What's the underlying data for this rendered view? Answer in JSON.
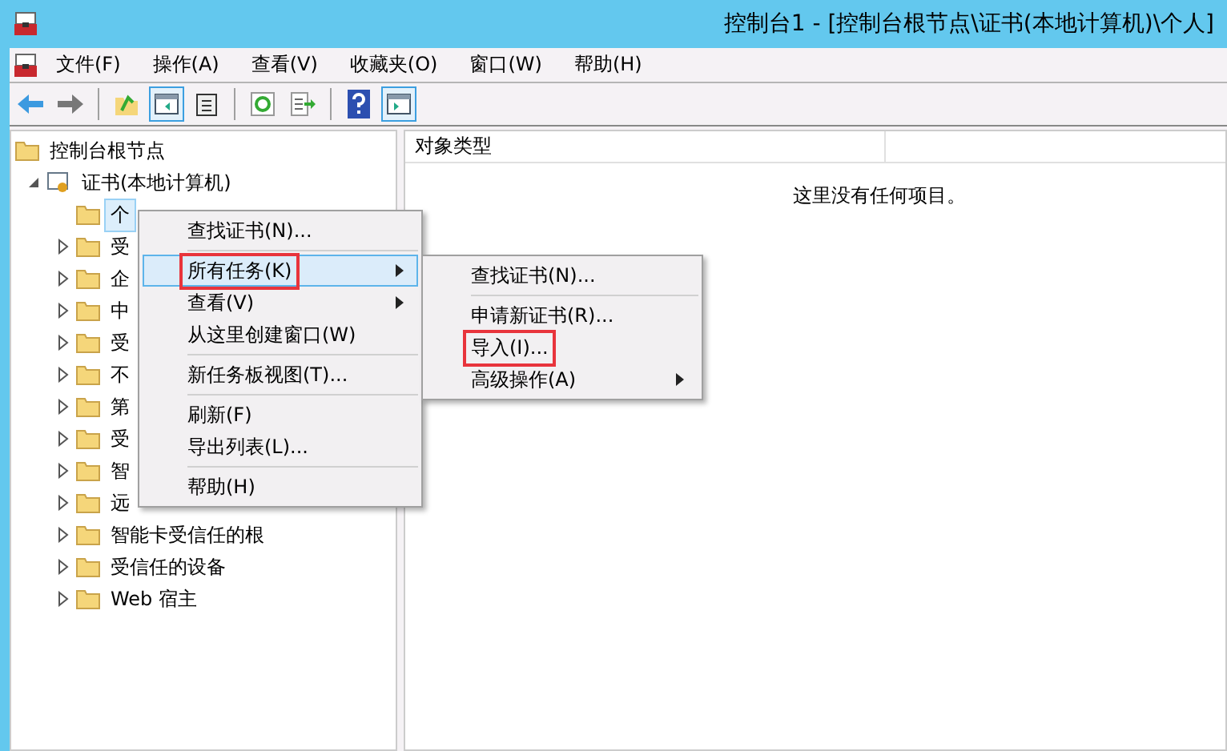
{
  "window": {
    "title": "控制台1 - [控制台根节点\\证书(本地计算机)\\个人]"
  },
  "menu_bar": [
    "文件(F)",
    "操作(A)",
    "查看(V)",
    "收藏夹(O)",
    "窗口(W)",
    "帮助(H)"
  ],
  "toolbar": [
    {
      "kind": "back",
      "pressed": false
    },
    {
      "kind": "forward",
      "pressed": false
    },
    {
      "kind": "sep"
    },
    {
      "kind": "up",
      "pressed": false
    },
    {
      "kind": "tree",
      "pressed": true
    },
    {
      "kind": "clipboard",
      "pressed": false
    },
    {
      "kind": "sep"
    },
    {
      "kind": "refresh",
      "pressed": false
    },
    {
      "kind": "export",
      "pressed": false
    },
    {
      "kind": "sep"
    },
    {
      "kind": "help",
      "pressed": false
    },
    {
      "kind": "action",
      "pressed": true
    }
  ],
  "tree": {
    "label": "控制台根节点",
    "children": [
      {
        "label": "证书(本地计算机)",
        "expanded": true,
        "children": [
          {
            "label": "个",
            "selected": true
          },
          {
            "label": "受",
            "selected": false
          },
          {
            "label": "企",
            "selected": false
          },
          {
            "label": "中",
            "selected": false
          },
          {
            "label": "受",
            "selected": false
          },
          {
            "label": "不",
            "selected": false
          },
          {
            "label": "第",
            "selected": false
          },
          {
            "label": "受",
            "selected": false
          },
          {
            "label": "智",
            "selected": false
          },
          {
            "label": "远",
            "selected": false
          },
          {
            "label": "智能卡受信任的根",
            "selected": false
          },
          {
            "label": "受信任的设备",
            "selected": false
          },
          {
            "label": "Web 宿主",
            "selected": false
          }
        ]
      }
    ]
  },
  "list": {
    "columns": [
      "对象类型"
    ],
    "empty_text": "这里没有任何项目。"
  },
  "context_menu": {
    "groups": [
      [
        {
          "label": "查找证书(N)...",
          "submenu": false,
          "selected": false,
          "annotated": false
        }
      ],
      [
        {
          "label": "所有任务(K)",
          "submenu": true,
          "selected": true,
          "annotated": true
        },
        {
          "label": "查看(V)",
          "submenu": true,
          "selected": false,
          "annotated": false
        },
        {
          "label": "从这里创建窗口(W)",
          "submenu": false,
          "selected": false,
          "annotated": false
        }
      ],
      [
        {
          "label": "新任务板视图(T)...",
          "submenu": false,
          "selected": false,
          "annotated": false
        }
      ],
      [
        {
          "label": "刷新(F)",
          "submenu": false,
          "selected": false,
          "annotated": false
        },
        {
          "label": "导出列表(L)...",
          "submenu": false,
          "selected": false,
          "annotated": false
        }
      ],
      [
        {
          "label": "帮助(H)",
          "submenu": false,
          "selected": false,
          "annotated": false
        }
      ]
    ]
  },
  "submenu": {
    "groups": [
      [
        {
          "label": "查找证书(N)...",
          "submenu": false,
          "selected": false,
          "annotated": false
        }
      ],
      [
        {
          "label": "申请新证书(R)...",
          "submenu": false,
          "selected": false,
          "annotated": false
        },
        {
          "label": "导入(I)...",
          "submenu": false,
          "selected": false,
          "annotated": true
        },
        {
          "label": "高级操作(A)",
          "submenu": true,
          "selected": false,
          "annotated": false
        }
      ]
    ]
  }
}
